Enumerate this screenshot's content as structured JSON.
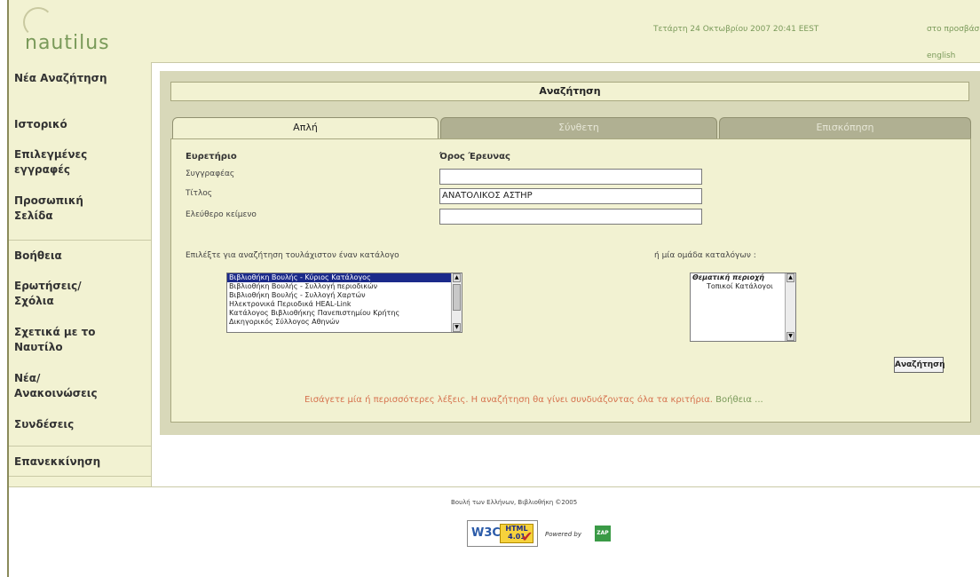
{
  "header": {
    "logo_text": "nautilus",
    "datetime": "Τετάρτη 24 Οκτωβρίου 2007 20:41 EEST",
    "links": [
      "στο προσβάσιμο",
      "english"
    ]
  },
  "sidebar": {
    "items": [
      {
        "label": "Νέα Αναζήτηση"
      },
      {
        "label": "Ιστορικό"
      },
      {
        "label": "Επιλεγμένες εγγραφές"
      },
      {
        "label": "Προσωπική Σελίδα"
      },
      {
        "label": "Βοήθεια"
      },
      {
        "label": "Ερωτήσεις/ Σχόλια"
      },
      {
        "label": "Σχετικά με το Ναυτίλο"
      },
      {
        "label": "Νέα/ Ανακοινώσεις"
      },
      {
        "label": "Συνδέσεις"
      },
      {
        "label": "Επανεκκίνηση"
      }
    ]
  },
  "main": {
    "title": "Αναζήτηση",
    "tabs": [
      {
        "label": "Απλή",
        "active": true
      },
      {
        "label": "Σύνθετη",
        "active": false
      },
      {
        "label": "Επισκόπηση",
        "active": false
      }
    ],
    "form": {
      "index_header": "Ευρετήριο",
      "term_header": "Όρος Έρευνας",
      "fields": [
        {
          "label": "Συγγραφέας",
          "value": ""
        },
        {
          "label": "Τίτλος",
          "value": "ΑΝΑΤΟΛΙΚΟΣ ΑΣΤΗΡ"
        },
        {
          "label": "Ελεύθερο κείμενο",
          "value": ""
        }
      ],
      "catalog_prompt": "Επιλέξτε για αναζήτηση τουλάχιστον έναν κατάλογο",
      "catalogs": [
        {
          "label": "Βιβλιοθήκη Βουλής - Κύριος Κατάλογος",
          "selected": true
        },
        {
          "label": "Βιβλιοθήκη Βουλής - Συλλογή περιοδικών",
          "selected": false
        },
        {
          "label": "Βιβλιοθήκη Βουλής - Συλλογή Χαρτών",
          "selected": false
        },
        {
          "label": "Ηλεκτρονικά Περιοδικά HEAL-Link",
          "selected": false
        },
        {
          "label": "Κατάλογος Βιβλιοθήκης Πανεπιστημίου Κρήτης",
          "selected": false
        },
        {
          "label": "Δικηγορικός Σύλλογος Αθηνών",
          "selected": false
        }
      ],
      "group_prompt": "ή μία ομάδα καταλόγων :",
      "groups": [
        {
          "label": "Θεματική περιοχή",
          "style": "bold-italic"
        },
        {
          "label": "Τοπικοί Κατάλογοι",
          "style": "normal"
        }
      ],
      "search_button": "Αναζήτηση",
      "hint_text": "Εισάγετε μία ή περισσότερες λέξεις. Η αναζήτηση θα γίνει συνδυάζοντας όλα τα κριτήρια.",
      "hint_help": "Βοήθεια ..."
    }
  },
  "footer": {
    "copyright": "Βουλή των Ελλήνων, Βιβλιοθήκη ©2005",
    "w3c_logo": "W3C",
    "w3c_badge_line1": "HTML",
    "w3c_badge_line2": "4.01",
    "powered_by": "Powered by",
    "zap": "ZAP"
  },
  "colors": {
    "panel_bg": "#f2f2d2",
    "main_bg": "#d8d8b9",
    "accent_green": "#7a9a5a",
    "hint_orange": "#d6734f",
    "selected_blue": "#1b2a8a"
  }
}
